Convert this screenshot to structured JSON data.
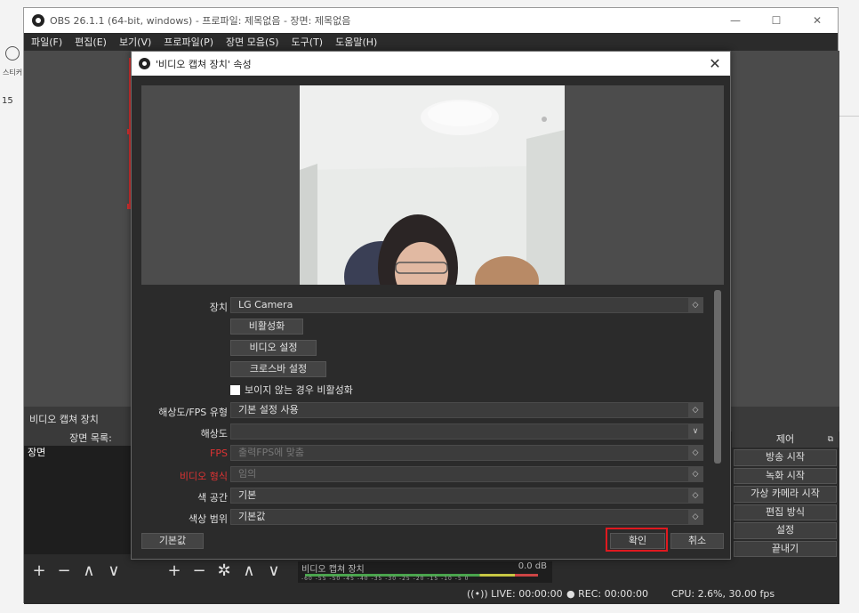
{
  "bg": {
    "sticker_label": "스티커",
    "number": "15"
  },
  "window": {
    "title": "OBS 26.1.1 (64-bit, windows) - 프로파일: 제목없음 - 장면: 제목없음",
    "minimize": "—",
    "maximize": "☐",
    "close": "✕"
  },
  "menu": [
    "파일(F)",
    "편집(E)",
    "보기(V)",
    "프로파일(P)",
    "장면 모음(S)",
    "도구(T)",
    "도움말(H)"
  ],
  "source_bar": {
    "label": "비디오 캡쳐 장치"
  },
  "scenes": {
    "header": "장면 목록:",
    "items": [
      "장면"
    ]
  },
  "toolbar": {
    "add": "+",
    "remove": "−",
    "up": "∧",
    "down": "∨",
    "gear": "✲"
  },
  "mixer": {
    "title": "비디오 캡쳐 장치",
    "db": "0.0 dB",
    "ticks": "-60 -55 -50 -45 -40 -35 -30 -25 -20 -15 -10 -5 0"
  },
  "controls": {
    "header": "제어",
    "pin": "⧉",
    "buttons": [
      "방송 시작",
      "녹화 시작",
      "가상 카메라 시작",
      "편집 방식",
      "설정",
      "끝내기"
    ]
  },
  "status": {
    "live": "LIVE: 00:00:00",
    "rec": "REC: 00:00:00",
    "cpu": "CPU: 2.6%, 30.00 fps",
    "live_icon": "((•))",
    "rec_icon": "●"
  },
  "dialog": {
    "title": "'비디오 캡쳐 장치' 속성",
    "close": "✕",
    "device": {
      "label": "장치",
      "value": "LG Camera"
    },
    "buttons": {
      "deactivate": "비활성화",
      "video_settings": "비디오 설정",
      "crossbar": "크로스바 설정"
    },
    "checkbox": {
      "label": "보이지 않는 경우 비활성화"
    },
    "res_type": {
      "label": "해상도/FPS 유형",
      "value": "기본 설정 사용"
    },
    "resolution": {
      "label": "해상도",
      "value": ""
    },
    "fps": {
      "label": "FPS",
      "value": "출력FPS에 맞춤"
    },
    "video_format": {
      "label": "비디오 형식",
      "value": "임의"
    },
    "color_space": {
      "label": "색 공간",
      "value": "기본"
    },
    "color_range": {
      "label": "색상 범위",
      "value": "기본값"
    },
    "footer": {
      "defaults": "기본값",
      "ok": "확인",
      "cancel": "취소"
    }
  },
  "colors": {
    "accent_red": "#e0191f",
    "panel": "#2b2b2b",
    "preview": "#4b4b4b"
  }
}
